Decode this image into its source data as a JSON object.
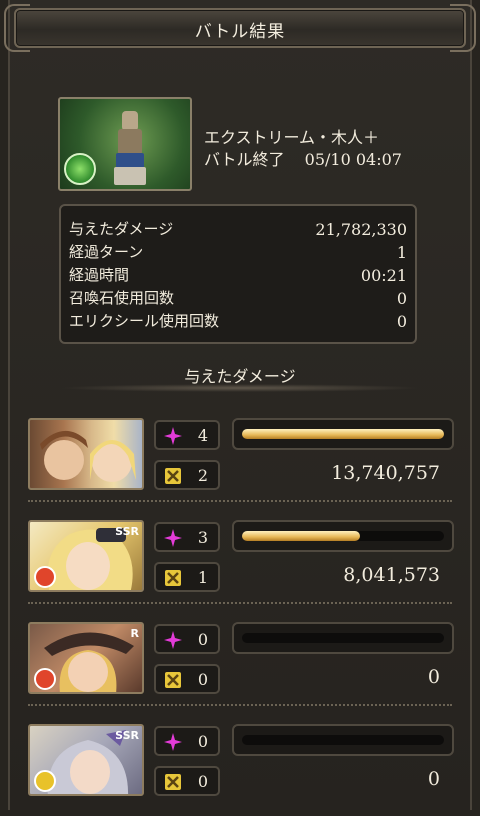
{
  "header": {
    "title": "バトル結果"
  },
  "quest": {
    "name": "エクストリーム・木人＋",
    "status": "バトル終了",
    "time": "05/10 04:07",
    "element_badge": "wind-icon"
  },
  "stats": [
    {
      "label": "与えたダメージ",
      "value": "21,782,330"
    },
    {
      "label": "経過ターン",
      "value": "1"
    },
    {
      "label": "経過時間",
      "value": "00:21"
    },
    {
      "label": "召喚石使用回数",
      "value": "0"
    },
    {
      "label": "エリクシール使用回数",
      "value": "0"
    }
  ],
  "section": {
    "title": "与えたダメージ"
  },
  "characters": [
    {
      "portrait": "duo-portrait",
      "rarity": "",
      "ougi": "4",
      "abilities": "2",
      "damage": "13,740,757",
      "damage_share": 1.0,
      "element_color": ""
    },
    {
      "portrait": "blonde-portrait",
      "rarity": "SSR",
      "ougi": "3",
      "abilities": "1",
      "damage": "8,041,573",
      "damage_share": 0.585,
      "element_color": "#e0452b"
    },
    {
      "portrait": "hat-portrait",
      "rarity": "R",
      "ougi": "0",
      "abilities": "0",
      "damage": "0",
      "damage_share": 0,
      "element_color": "#e0452b"
    },
    {
      "portrait": "silver-portrait",
      "rarity": "SSR",
      "ougi": "0",
      "abilities": "0",
      "damage": "0",
      "damage_share": 0,
      "element_color": "#e8c22a"
    }
  ],
  "colors": {
    "accent": "#e7b857",
    "ougi": "#e33bd8",
    "ability": "#e7c63a"
  }
}
